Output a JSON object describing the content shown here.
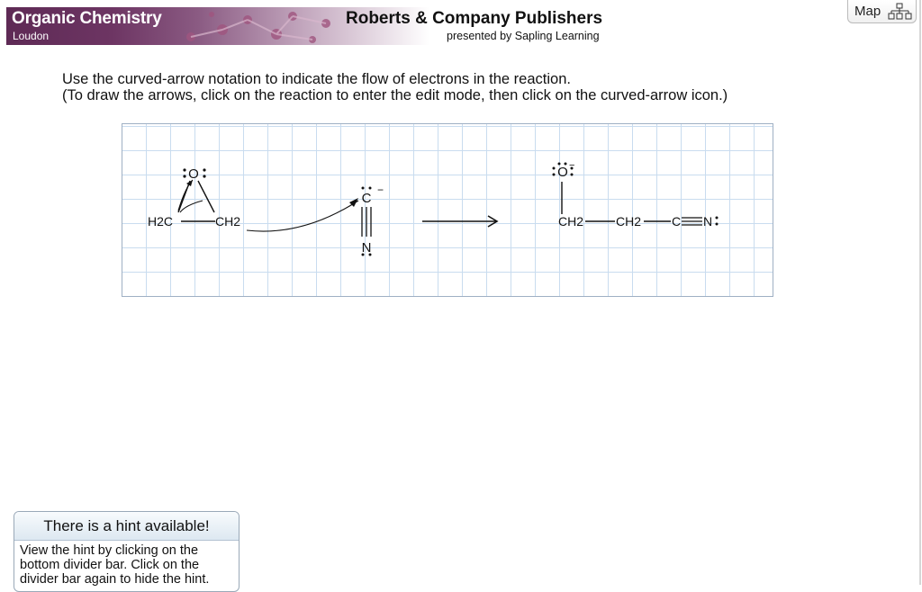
{
  "header": {
    "course_title": "Organic Chemistry",
    "author": "Loudon",
    "publisher": "Roberts & Company Publishers",
    "presented_by": "presented by Sapling Learning"
  },
  "map_button": {
    "label": "Map",
    "icon": "map-sitemap-icon"
  },
  "instructions": {
    "line1": "Use the curved-arrow notation to indicate the flow of electrons in the reaction.",
    "line2": "(To draw the arrows, click on the reaction to enter the edit mode, then click on the curved-arrow icon.)"
  },
  "reaction": {
    "reactant_epoxide": {
      "oxygen": "O",
      "carbon_left": "H2C",
      "carbon_right": "CH2"
    },
    "reactant_cyanide": {
      "carbon": "C",
      "nitrogen": "N",
      "charge": "−"
    },
    "product": {
      "oxygen": "O",
      "charge": "−",
      "ch2_a": "CH2",
      "ch2_b": "CH2",
      "carbon": "C",
      "nitrogen": "N"
    }
  },
  "hint": {
    "title": "There is a hint available!",
    "body_line1": "View the hint by clicking on the",
    "body_line2": "bottom divider bar. Click on the",
    "body_line3": "divider bar again to hide the hint."
  },
  "colors": {
    "banner": "#5e2a55",
    "grid": "#c9dcef",
    "hint_header": "#dde8f1"
  }
}
